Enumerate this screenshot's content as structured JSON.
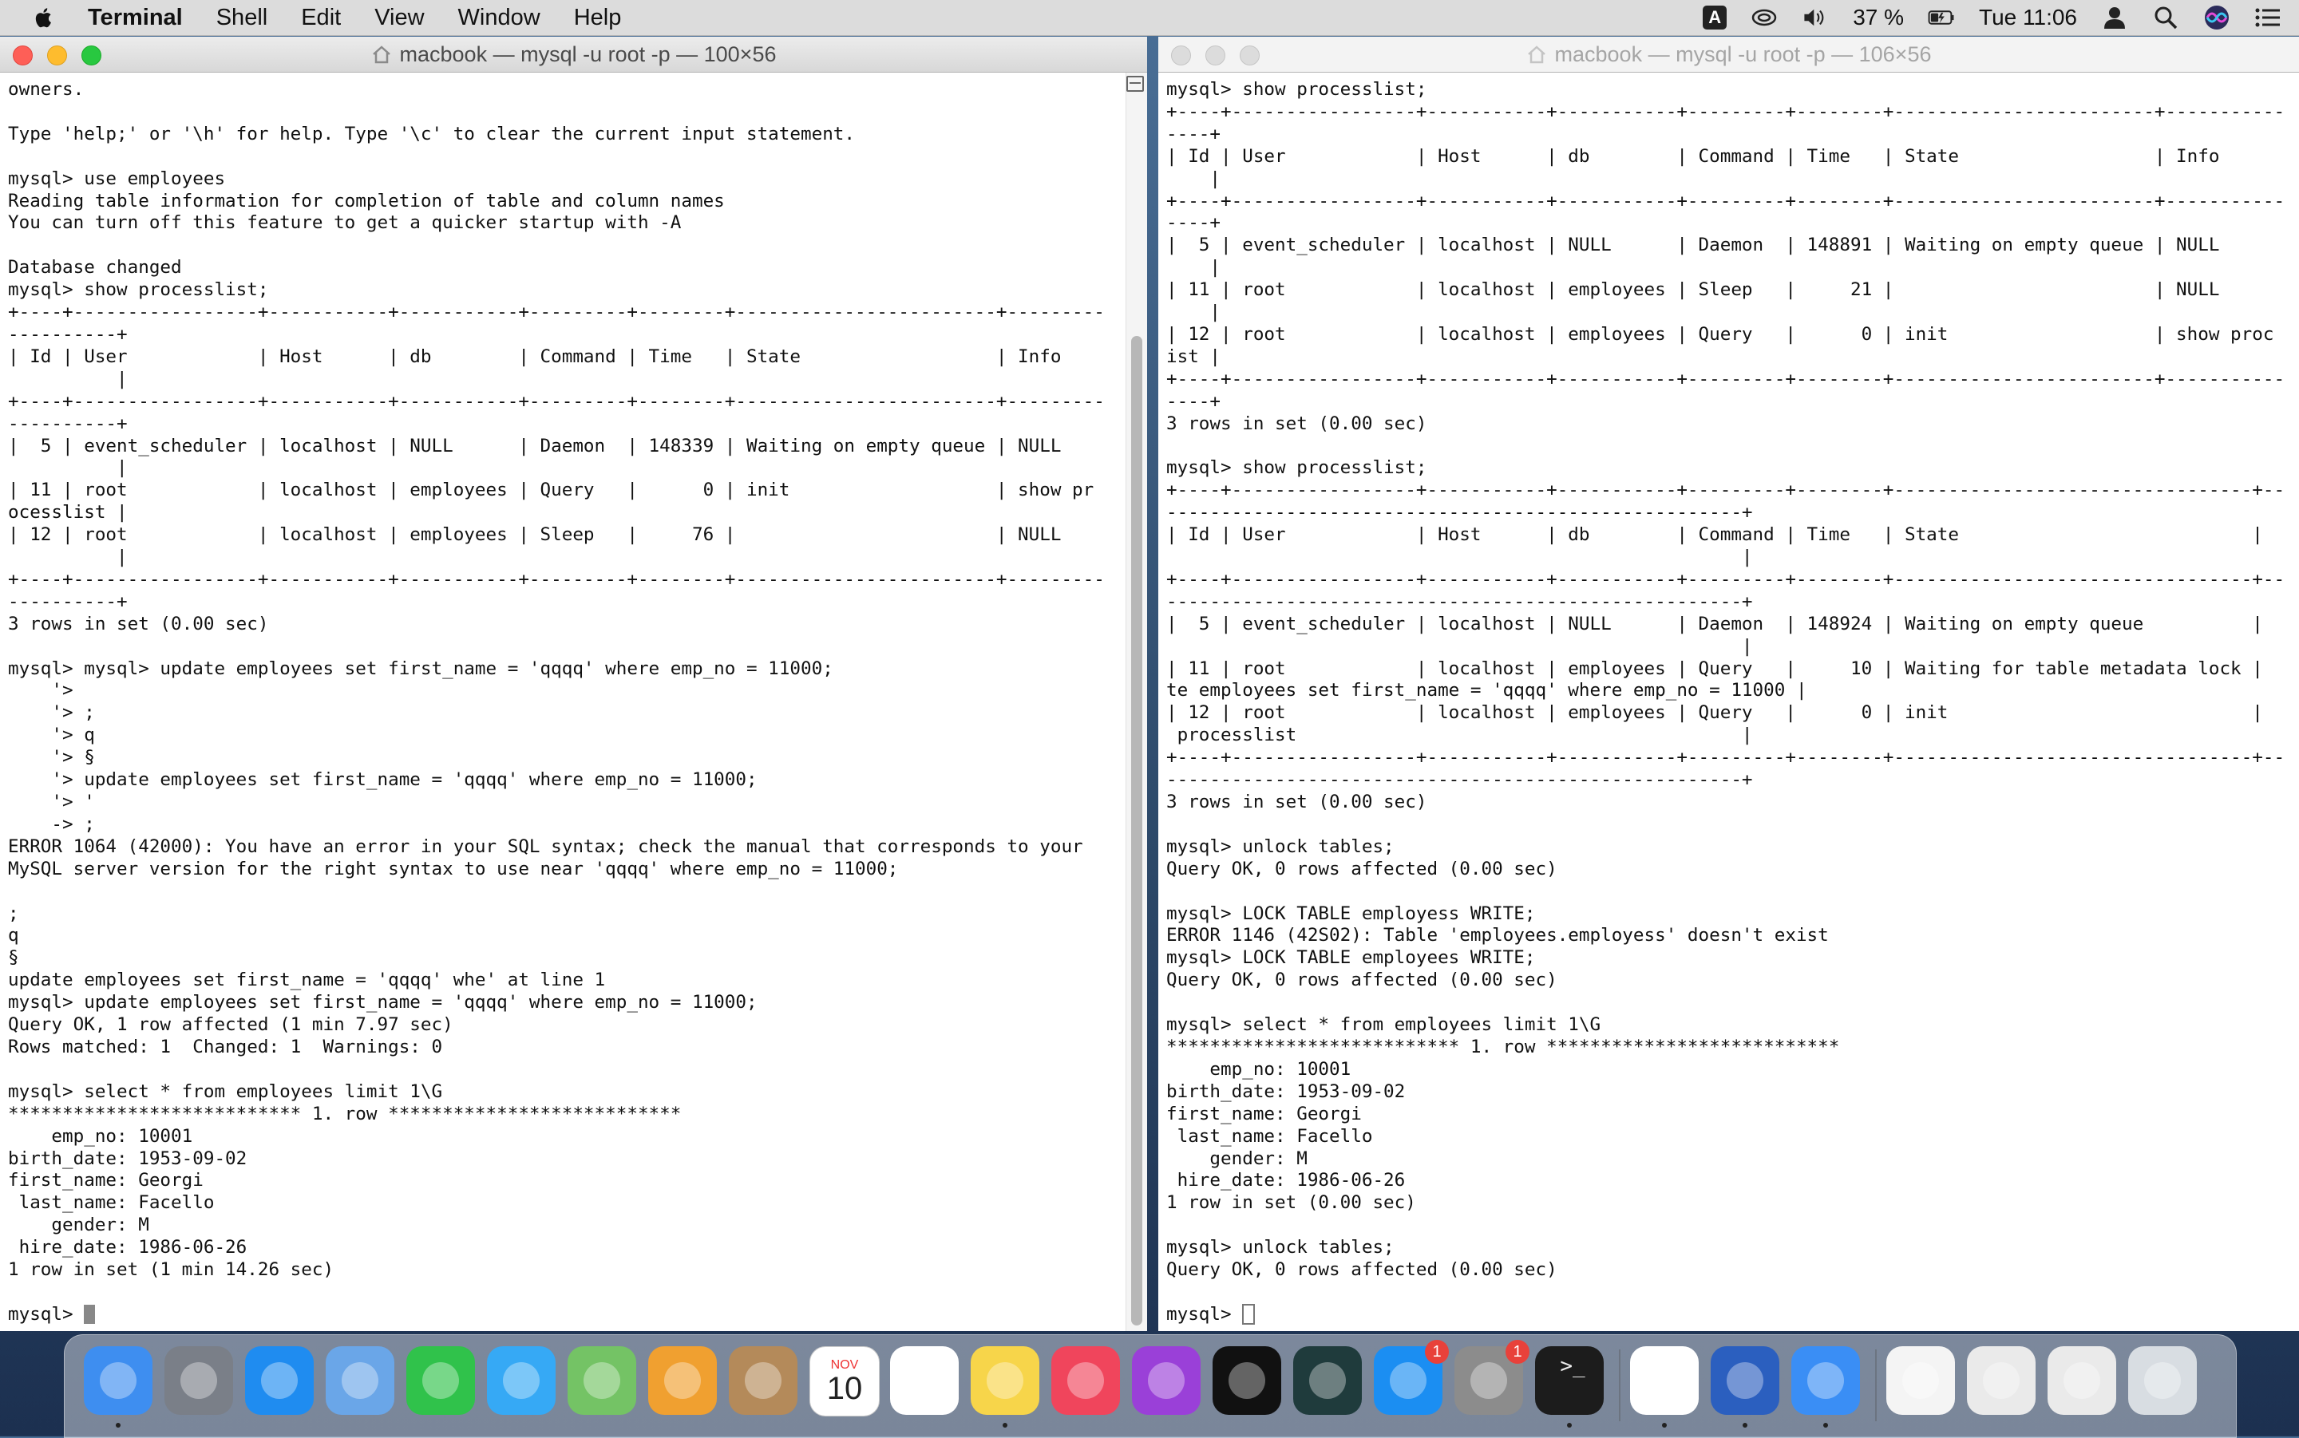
{
  "menubar": {
    "app": "Terminal",
    "items": [
      "Shell",
      "Edit",
      "View",
      "Window",
      "Help"
    ],
    "status": {
      "input_source": "A",
      "battery": "37 %",
      "clock": "Tue 11:06"
    }
  },
  "window_left": {
    "title": "macbook — mysql -u root -p — 100×56",
    "text": "owners.\n\nType 'help;' or '\\h' for help. Type '\\c' to clear the current input statement.\n\nmysql> use employees\nReading table information for completion of table and column names\nYou can turn off this feature to get a quicker startup with -A\n\nDatabase changed\nmysql> show processlist;\n+----+-----------------+-----------+-----------+---------+--------+------------------------+---------\n----------+\n| Id | User            | Host      | db        | Command | Time   | State                  | Info    \n          |\n+----+-----------------+-----------+-----------+---------+--------+------------------------+---------\n----------+\n|  5 | event_scheduler | localhost | NULL      | Daemon  | 148339 | Waiting on empty queue | NULL    \n          |\n| 11 | root            | localhost | employees | Query   |      0 | init                   | show pr\nocesslist |\n| 12 | root            | localhost | employees | Sleep   |     76 |                        | NULL    \n          |\n+----+-----------------+-----------+-----------+---------+--------+------------------------+---------\n----------+\n3 rows in set (0.00 sec)\n\nmysql> mysql> update employees set first_name = 'qqqq' where emp_no = 11000;\n    '>\n    '> ;\n    '> q\n    '> §\n    '> update employees set first_name = 'qqqq' where emp_no = 11000;\n    '> '\n    -> ;\nERROR 1064 (42000): You have an error in your SQL syntax; check the manual that corresponds to your\nMySQL server version for the right syntax to use near 'qqqq' where emp_no = 11000;\n\n;\nq\n§\nupdate employees set first_name = 'qqqq' whe' at line 1\nmysql> update employees set first_name = 'qqqq' where emp_no = 11000;\nQuery OK, 1 row affected (1 min 7.97 sec)\nRows matched: 1  Changed: 1  Warnings: 0\n\nmysql> select * from employees limit 1\\G\n*************************** 1. row ***************************\n    emp_no: 10001\nbirth_date: 1953-09-02\nfirst_name: Georgi\n last_name: Facello\n    gender: M\n hire_date: 1986-06-26\n1 row in set (1 min 14.26 sec)\n\n",
    "prompt": "mysql> "
  },
  "window_right": {
    "title": "macbook — mysql -u root -p — 106×56",
    "text": "mysql> show processlist;\n+----+-----------------+-----------+-----------+---------+--------+------------------------+-----------\n----+\n| Id | User            | Host      | db        | Command | Time   | State                  | Info      \n    |\n+----+-----------------+-----------+-----------+---------+--------+------------------------+-----------\n----+\n|  5 | event_scheduler | localhost | NULL      | Daemon  | 148891 | Waiting on empty queue | NULL      \n    |\n| 11 | root            | localhost | employees | Sleep   |     21 |                        | NULL      \n    |\n| 12 | root            | localhost | employees | Query   |      0 | init                   | show proc\nist |\n+----+-----------------+-----------+-----------+---------+--------+------------------------+-----------\n----+\n3 rows in set (0.00 sec)\n\nmysql> show processlist;\n+----+-----------------+-----------+-----------+---------+--------+---------------------------------+--\n-----------------------------------------------------+\n| Id | User            | Host      | db        | Command | Time   | State                           | \n                                                     |\n+----+-----------------+-----------+-----------+---------+--------+---------------------------------+--\n-----------------------------------------------------+\n|  5 | event_scheduler | localhost | NULL      | Daemon  | 148924 | Waiting on empty queue          | \n                                                     |\n| 11 | root            | localhost | employees | Query   |     10 | Waiting for table metadata lock | \nte employees set first_name = 'qqqq' where emp_no = 11000 |\n| 12 | root            | localhost | employees | Query   |      0 | init                            | \n processlist                                         |\n+----+-----------------+-----------+-----------+---------+--------+---------------------------------+--\n-----------------------------------------------------+\n3 rows in set (0.00 sec)\n\nmysql> unlock tables;\nQuery OK, 0 rows affected (0.00 sec)\n\nmysql> LOCK TABLE employess WRITE;\nERROR 1146 (42S02): Table 'employees.employess' doesn't exist\nmysql> LOCK TABLE employees WRITE;\nQuery OK, 0 rows affected (0.00 sec)\n\nmysql> select * from employees limit 1\\G\n*************************** 1. row ***************************\n    emp_no: 10001\nbirth_date: 1953-09-02\nfirst_name: Georgi\n last_name: Facello\n    gender: M\n hire_date: 1986-06-26\n1 row in set (0.00 sec)\n\nmysql> unlock tables;\nQuery OK, 0 rows affected (0.00 sec)\n\n",
    "prompt": "mysql> "
  },
  "dock": {
    "apps": [
      {
        "name": "Finder",
        "color": "#3e8ef0",
        "running": true
      },
      {
        "name": "Launchpad",
        "color": "#7a7f88",
        "running": false
      },
      {
        "name": "Safari",
        "color": "#1f8cf0",
        "running": false
      },
      {
        "name": "Mail",
        "color": "#6aa6e8",
        "running": false
      },
      {
        "name": "FaceTime",
        "color": "#30c24b",
        "running": false
      },
      {
        "name": "Messages",
        "color": "#36a9f5",
        "running": false
      },
      {
        "name": "Maps",
        "color": "#74c365",
        "running": false
      },
      {
        "name": "Photos",
        "color": "#f0a030",
        "running": false
      },
      {
        "name": "Contacts",
        "color": "#b48a5a",
        "running": false
      },
      {
        "name": "Calendar",
        "color": "#ffffff",
        "running": false
      },
      {
        "name": "Reminders",
        "color": "#ffffff",
        "running": false
      },
      {
        "name": "Notes",
        "color": "#f7d54a",
        "running": true
      },
      {
        "name": "Music",
        "color": "#f0455c",
        "running": false
      },
      {
        "name": "Podcasts",
        "color": "#9a40d8",
        "running": false
      },
      {
        "name": "TV",
        "color": "#111111",
        "running": false
      },
      {
        "name": "GitKraken",
        "color": "#1f3b3c",
        "running": false
      },
      {
        "name": "App Store",
        "color": "#1b8ef2",
        "running": false
      },
      {
        "name": "System Preferences",
        "color": "#8c8c8c",
        "running": false
      },
      {
        "name": "Terminal",
        "color": "#1c1c1c",
        "running": true
      },
      {
        "name": "Chrome",
        "color": "#ffffff",
        "running": true
      },
      {
        "name": "Word",
        "color": "#2b5fbf",
        "running": true
      },
      {
        "name": "Xcode",
        "color": "#3a8ef5",
        "running": true
      },
      {
        "name": "Document",
        "color": "#f4f4f4",
        "running": false
      },
      {
        "name": "Screenshot 1",
        "color": "#eaeaea",
        "running": false
      },
      {
        "name": "Screenshot 2",
        "color": "#eaeaea",
        "running": false
      },
      {
        "name": "Trash",
        "color": "#d8dde2",
        "running": false
      }
    ],
    "calendar": {
      "month": "NOV",
      "day": "10"
    },
    "badges": {
      "App Store": "1",
      "System Preferences": "1"
    },
    "terminal_glyph": ">_"
  }
}
